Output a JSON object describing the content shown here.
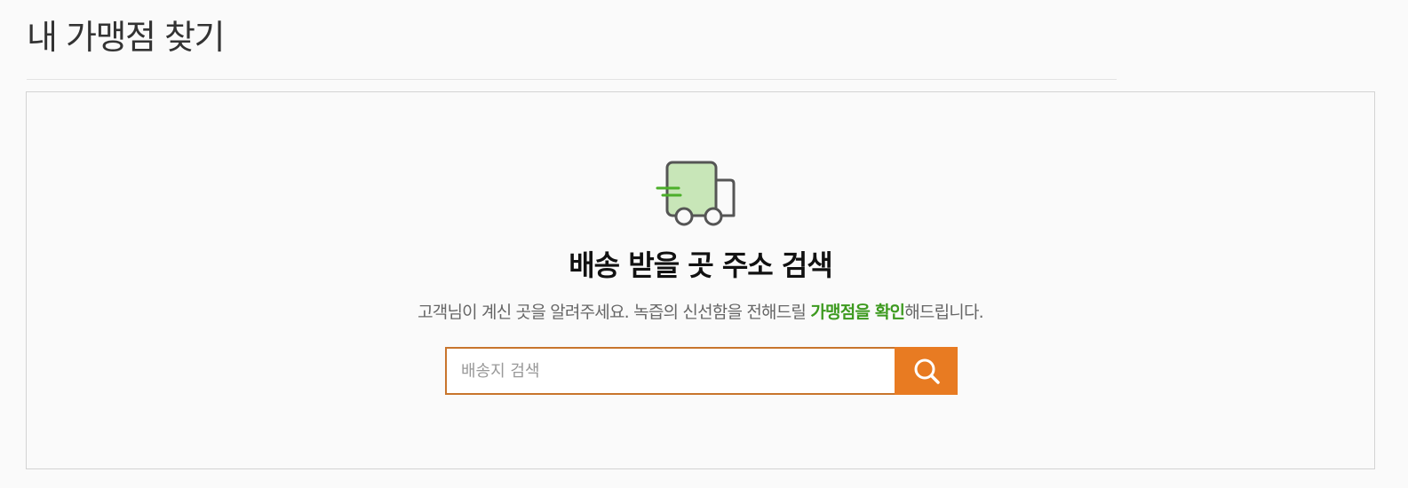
{
  "page": {
    "title": "내 가맹점 찾기"
  },
  "panel": {
    "heading": "배송 받을 곳 주소 검색",
    "description_prefix": "고객님이 계신 곳을 알려주세요. 녹즙의 신선함을 전해드릴 ",
    "description_highlight": "가맹점을 확인",
    "description_suffix": "해드립니다.",
    "icon": "delivery-truck-icon"
  },
  "search": {
    "placeholder": "배송지 검색",
    "value": "",
    "button_icon": "search-icon"
  },
  "colors": {
    "accent": "#e87b22",
    "input_border": "#c8752c",
    "highlight": "#3d9a1f",
    "truck_fill": "#c8e6b8",
    "truck_outline": "#555555",
    "speed_lines": "#4caf2a"
  }
}
